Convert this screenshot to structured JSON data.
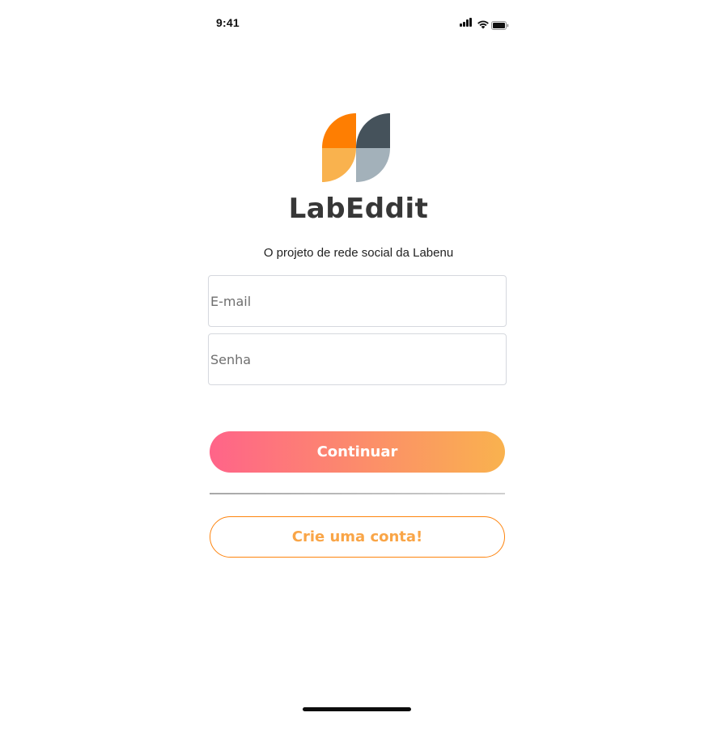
{
  "status_bar": {
    "time": "9:41",
    "icons": [
      "cellular-signal-icon",
      "wifi-icon",
      "battery-icon"
    ]
  },
  "brand": {
    "logo_icon": "labeddit-logo-icon",
    "title": "LabEddit",
    "subtitle": "O projeto de rede social da Labenu",
    "colors": {
      "orange": "#FE7E02",
      "light_orange": "#F9B24E",
      "dark_slate": "#45525B",
      "light_slate": "#A3B1BA"
    }
  },
  "login_form": {
    "email_placeholder": "E-mail",
    "email_value": "",
    "password_placeholder": "Senha",
    "password_value": "",
    "continue_label": "Continuar",
    "signup_label": "Crie uma conta!"
  },
  "theme": {
    "gradient_start": "#FF6489",
    "gradient_end": "#F9B24E",
    "accent": "#FE7E02"
  }
}
